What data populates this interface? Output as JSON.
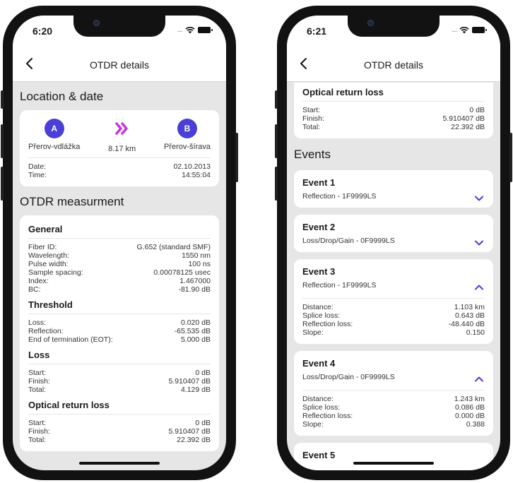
{
  "left": {
    "time": "6:20",
    "nav_title": "OTDR details",
    "location_section": "Location & date",
    "point_a": {
      "badge": "A",
      "name": "Přerov-vdlážka"
    },
    "distance": "8.17 km",
    "point_b": {
      "badge": "B",
      "name": "Přerov-šírava"
    },
    "date": {
      "label": "Date:",
      "value": "02.10.2013"
    },
    "time_row": {
      "label": "Time:",
      "value": "14:55:04"
    },
    "measurement_section": "OTDR measurment",
    "general": {
      "title": "General",
      "rows": [
        {
          "label": "Fiber ID:",
          "value": "G.652 (standard SMF)"
        },
        {
          "label": "Wavelength:",
          "value": "1550 nm"
        },
        {
          "label": "Pulse width:",
          "value": "100 ns"
        },
        {
          "label": "Sample spacing:",
          "value": "0.00078125 usec"
        },
        {
          "label": "Index:",
          "value": "1.467000"
        },
        {
          "label": "BC:",
          "value": "-81.90 dB"
        }
      ]
    },
    "threshold": {
      "title": "Threshold",
      "rows": [
        {
          "label": "Loss:",
          "value": "0.020 dB"
        },
        {
          "label": "Reflection:",
          "value": "-65.535 dB"
        },
        {
          "label": "End of termination (EOT):",
          "value": "5.000 dB"
        }
      ]
    },
    "loss": {
      "title": "Loss",
      "rows": [
        {
          "label": "Start:",
          "value": "0 dB"
        },
        {
          "label": "Finish:",
          "value": "5.910407 dB"
        },
        {
          "label": "Total:",
          "value": "4.129 dB"
        }
      ]
    },
    "orl": {
      "title": "Optical return loss",
      "rows": [
        {
          "label": "Start:",
          "value": "0 dB"
        },
        {
          "label": "Finish:",
          "value": "5.910407 dB"
        },
        {
          "label": "Total:",
          "value": "22.392 dB"
        }
      ]
    }
  },
  "right": {
    "time": "6:21",
    "nav_title": "OTDR details",
    "orl": {
      "title": "Optical return loss",
      "rows": [
        {
          "label": "Start:",
          "value": "0 dB"
        },
        {
          "label": "Finish:",
          "value": "5.910407 dB"
        },
        {
          "label": "Total:",
          "value": "22.392 dB"
        }
      ]
    },
    "events_section": "Events",
    "events": [
      {
        "title": "Event 1",
        "desc": "Reflection - 1F9999LS"
      },
      {
        "title": "Event 2",
        "desc": "Loss/Drop/Gain - 0F9999LS"
      },
      {
        "title": "Event 3",
        "desc": "Reflection - 1F9999LS",
        "rows": [
          {
            "label": "Distance:",
            "value": "1.103 km"
          },
          {
            "label": "Splice loss:",
            "value": "0.643 dB"
          },
          {
            "label": "Reflection loss:",
            "value": "-48.440 dB"
          },
          {
            "label": "Slope:",
            "value": "0.150"
          }
        ]
      },
      {
        "title": "Event 4",
        "desc": "Loss/Drop/Gain - 0F9999LS",
        "rows": [
          {
            "label": "Distance:",
            "value": "1.243 km"
          },
          {
            "label": "Splice loss:",
            "value": "0.086 dB"
          },
          {
            "label": "Reflection loss:",
            "value": "0.000 dB"
          },
          {
            "label": "Slope:",
            "value": "0.388"
          }
        ]
      },
      {
        "title": "Event 5"
      }
    ]
  },
  "colors": {
    "accent": "#4a3fd6",
    "arrows": "#c733e0",
    "background": "#e6e6e6"
  }
}
